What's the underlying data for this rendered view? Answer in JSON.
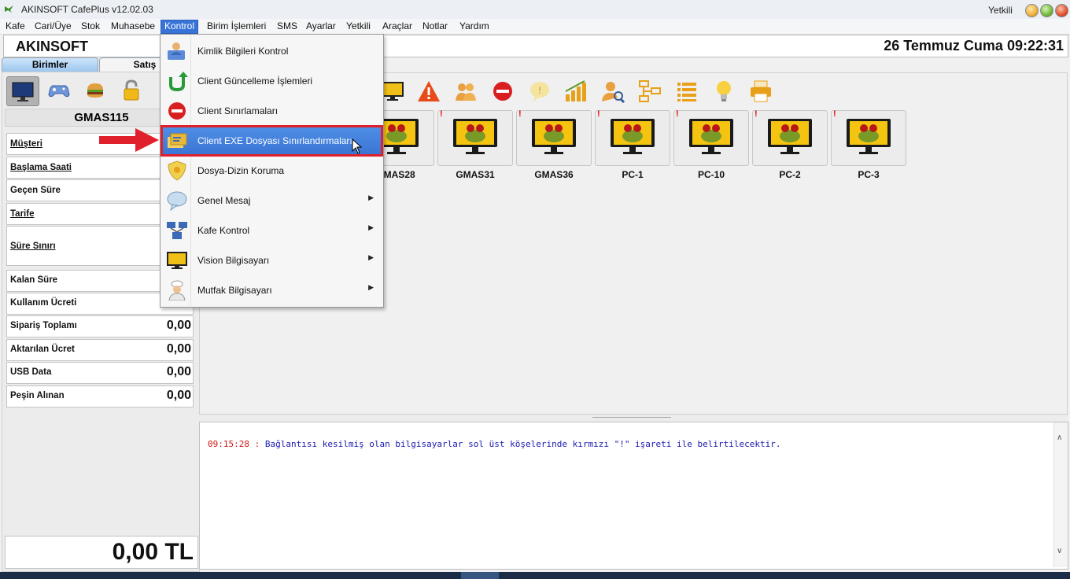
{
  "window": {
    "title": "AKINSOFT CafePlus v12.02.03",
    "user": "Yetkili"
  },
  "menubar": [
    "Kafe",
    "Cari/Üye",
    "Stok",
    "Muhasebe",
    "Kontrol",
    "Birim İşlemleri",
    "SMS",
    "Ayarlar",
    "Yetkili",
    "Araçlar",
    "Notlar",
    "Yardım"
  ],
  "header": {
    "brand": "AKINSOFT",
    "datetime": "26 Temmuz Cuma  09:22:31"
  },
  "tabs": {
    "birimler": "Birimler",
    "satis": "Satış"
  },
  "left": {
    "pc_name": "GMAS115",
    "rows": [
      {
        "label": "Müşteri",
        "value": ""
      },
      {
        "label": "Başlama Saati",
        "value": ""
      },
      {
        "label": "Geçen Süre",
        "value": ""
      },
      {
        "label": "Tarife",
        "value": ""
      },
      {
        "label": "Süre Sınırı",
        "value": ""
      },
      {
        "label": "Kalan Süre",
        "value": ""
      },
      {
        "label": "Kullanım Ücreti",
        "value": ""
      },
      {
        "label": "Sipariş Toplamı",
        "value": "0,00"
      },
      {
        "label": "Aktarılan Ücret",
        "value": "0,00"
      },
      {
        "label": "USB Data",
        "value": "0,00"
      },
      {
        "label": "Peşin Alınan",
        "value": "0,00"
      }
    ],
    "total": "0,00 TL"
  },
  "computers": [
    "GMAS28",
    "GMAS31",
    "GMAS36",
    "PC-1",
    "PC-10",
    "PC-2",
    "PC-3"
  ],
  "log": {
    "time": "09:15:28 :",
    "message": "Bağlantısı kesilmiş olan bilgisayarlar sol üst köşelerinde kırmızı \"!\" işareti ile belirtilecektir."
  },
  "kontrol_menu": [
    {
      "label": "Kimlik Bilgileri Kontrol",
      "icon": "id-card-user-icon"
    },
    {
      "label": "Client Güncelleme İşlemleri",
      "icon": "green-update-arrow-icon"
    },
    {
      "label": "Client Sınırlamaları",
      "icon": "red-stop-icon"
    },
    {
      "label": "Client EXE Dosyası Sınırlandırmaları",
      "icon": "exe-restriction-icon",
      "highlighted": true
    },
    {
      "label": "Dosya-Dizin Koruma",
      "icon": "shield-icon"
    },
    {
      "label": "Genel Mesaj",
      "icon": "speech-bubble-icon",
      "submenu": true
    },
    {
      "label": "Kafe Kontrol",
      "icon": "network-computers-icon",
      "submenu": true
    },
    {
      "label": "Vision Bilgisayarı",
      "icon": "monitor-icon",
      "submenu": true
    },
    {
      "label": "Mutfak Bilgisayarı",
      "icon": "chef-icon",
      "submenu": true
    }
  ],
  "colors": {
    "menu_highlight": "#3a74d4",
    "annotation_red": "#e0202a",
    "log_time": "#d01818",
    "log_message": "#1a1ab0"
  }
}
